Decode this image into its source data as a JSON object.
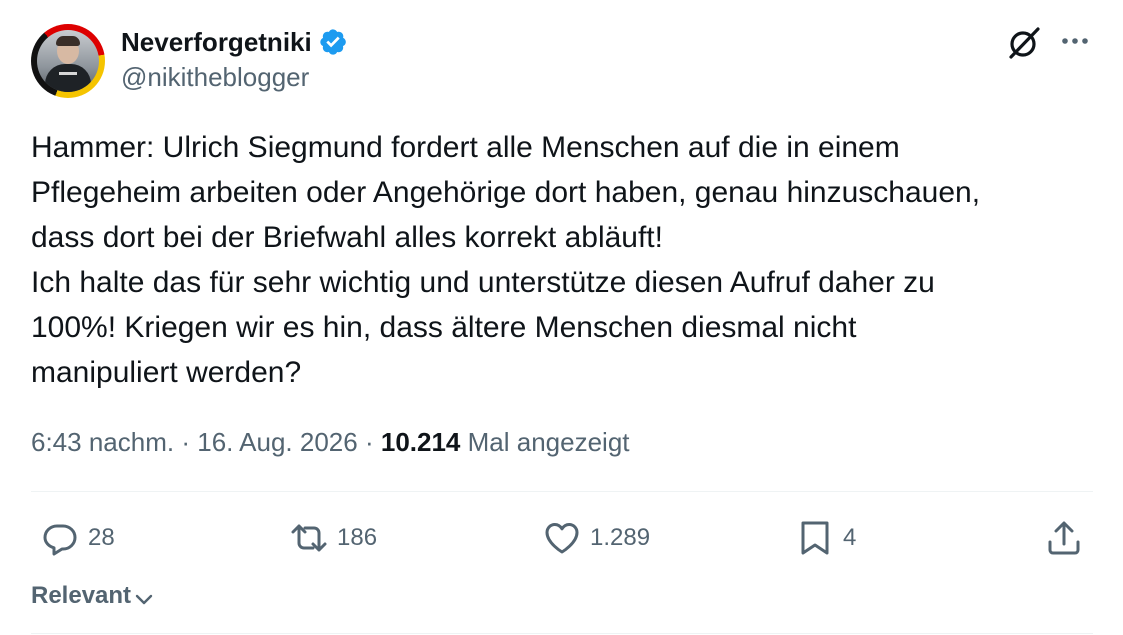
{
  "author": {
    "display_name": "Neverforgetniki",
    "handle": "@nikitheblogger",
    "verified": true
  },
  "tweet": {
    "text": "Hammer: Ulrich Siegmund fordert alle Menschen auf die in einem\nPflegeheim arbeiten oder Angehörige dort haben, genau hinzuschauen,\ndass dort bei der Briefwahl alles korrekt abläuft!\nIch halte das für sehr wichtig und unterstütze diesen Aufruf daher zu\n100%! Kriegen wir es hin, dass ältere Menschen diesmal nicht\nmanipuliert werden?",
    "time": "6:43 nachm.",
    "separator": "·",
    "date": "16. Aug. 2026",
    "views_count": "10.214",
    "views_label": "Mal angezeigt"
  },
  "actions": {
    "replies": "28",
    "retweets": "186",
    "likes": "1.289",
    "bookmarks": "4"
  },
  "replies_sort": {
    "label": "Relevant"
  },
  "icons": {
    "verified": "verified-badge-icon",
    "grok": "grok-icon",
    "more": "more-dots-icon",
    "reply": "reply-bubble-icon",
    "retweet": "retweet-icon",
    "like": "heart-icon",
    "bookmark": "bookmark-icon",
    "share": "share-upload-icon",
    "sort": "chevron-down-icon"
  },
  "colors": {
    "text_primary": "#0f1419",
    "text_secondary": "#536471",
    "verified_blue": "#1d9bf0",
    "divider": "#eff3f4"
  }
}
